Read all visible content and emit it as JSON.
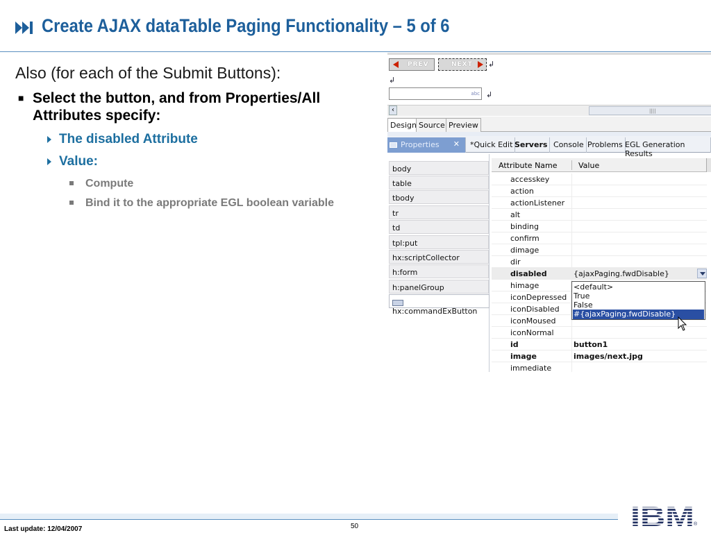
{
  "slide": {
    "title": "Create AJAX dataTable Paging Functionality – 5 of 6",
    "title_icon": "fast-forward-icon",
    "intro": "Also (for each of the Submit Buttons):",
    "bullet1": "Select the button, and from Properties/All Attributes specify:",
    "sub1": "The disabled Attribute",
    "sub2": "Value:",
    "sub2_items": [
      "Compute",
      "Bind it to the appropriate EGL boolean variable"
    ],
    "colors": {
      "title": "#1d5f9b",
      "sub": "#1d6fa0",
      "grey": "#7a7a7a",
      "selection": "#2a4fa3"
    }
  },
  "screenshot": {
    "prev_label": "PREV",
    "next_label": "NEXT",
    "return_mark": "↲",
    "spell_mark": "abc",
    "editor_tabs": [
      "Design",
      "Source",
      "Preview"
    ],
    "view_tabs": {
      "properties": "Properties",
      "others": [
        "*Quick Edit",
        "Servers",
        "Console",
        "Problems",
        "EGL Generation Results"
      ]
    },
    "tree_items": [
      "body",
      "table",
      "tbody",
      "tr",
      "td",
      "tpl:put",
      "hx:scriptCollector",
      "h:form",
      "h:panelGroup",
      "hx:commandExButton"
    ],
    "table_header": {
      "attr": "Attribute Name",
      "value": "Value"
    },
    "rows": [
      {
        "k": "accesskey",
        "v": ""
      },
      {
        "k": "action",
        "v": ""
      },
      {
        "k": "actionListener",
        "v": ""
      },
      {
        "k": "alt",
        "v": ""
      },
      {
        "k": "binding",
        "v": ""
      },
      {
        "k": "confirm",
        "v": ""
      },
      {
        "k": "dimage",
        "v": ""
      },
      {
        "k": "dir",
        "v": ""
      },
      {
        "k": "disabled",
        "v": "{ajaxPaging.fwdDisable}"
      },
      {
        "k": "himage",
        "v": ""
      },
      {
        "k": "iconDepressed",
        "v": ""
      },
      {
        "k": "iconDisabled",
        "v": ""
      },
      {
        "k": "iconMoused",
        "v": ""
      },
      {
        "k": "iconNormal",
        "v": ""
      },
      {
        "k": "id",
        "v": "button1"
      },
      {
        "k": "image",
        "v": "images/next.jpg"
      },
      {
        "k": "immediate",
        "v": ""
      }
    ],
    "dropdown_options": [
      "<default>",
      "True",
      "False",
      "#{ajaxPaging.fwdDisable}"
    ]
  },
  "footer": {
    "last_update": "Last update: 12/04/2007",
    "page": "50",
    "logo": "IBM",
    "trademark": "®"
  }
}
